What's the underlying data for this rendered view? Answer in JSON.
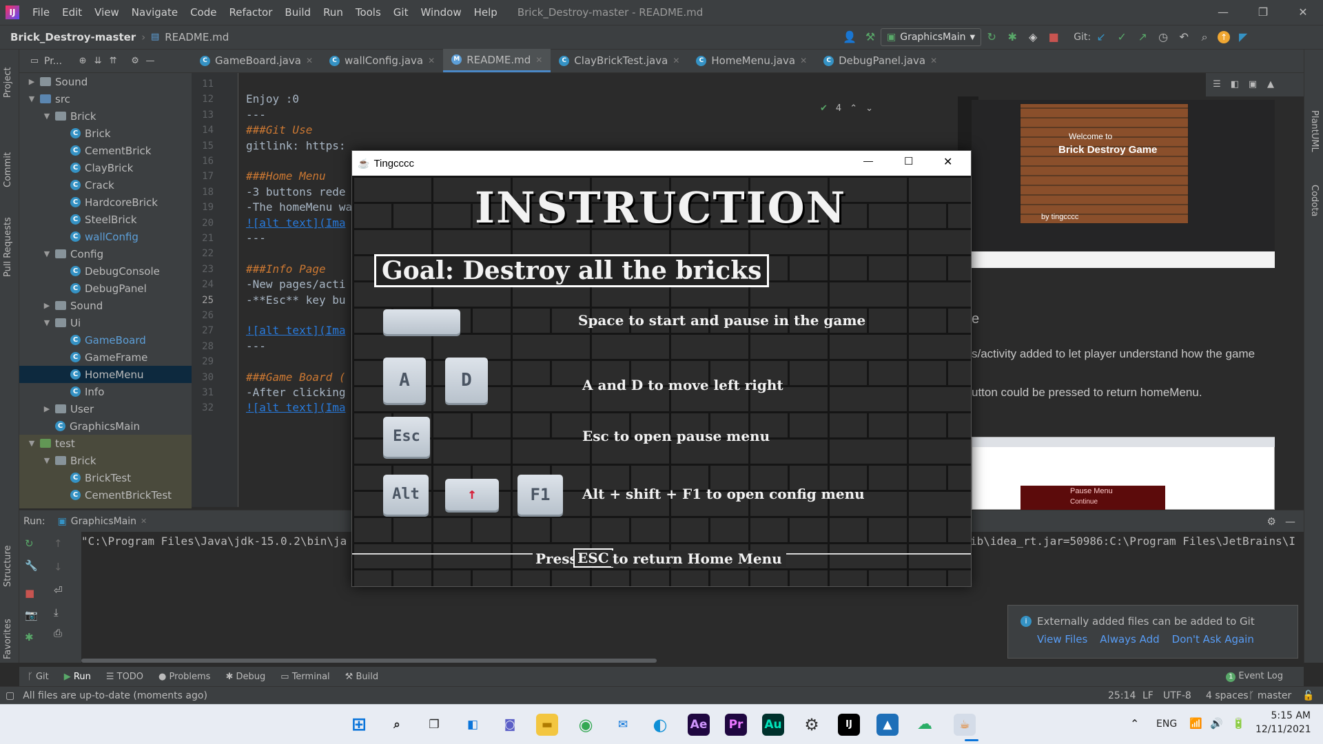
{
  "titlebar": {
    "menus": [
      "File",
      "Edit",
      "View",
      "Navigate",
      "Code",
      "Refactor",
      "Build",
      "Run",
      "Tools",
      "Git",
      "Window",
      "Help"
    ],
    "window_title": "Brick_Destroy-master - README.md"
  },
  "navbar": {
    "project": "Brick_Destroy-master",
    "file": "README.md",
    "run_config": "GraphicsMain",
    "git_label": "Git:"
  },
  "left_strip": {
    "tabs": [
      "Project",
      "Commit",
      "Pull Requests",
      "Structure",
      "Favorites"
    ]
  },
  "right_strip": {
    "tabs": [
      "PlantUML",
      "Codota"
    ]
  },
  "project_panel": {
    "header": "Pr...",
    "tree": [
      {
        "label": "Sound",
        "indent": 1,
        "type": "folder",
        "arrow": "▶"
      },
      {
        "label": "src",
        "indent": 1,
        "type": "src",
        "arrow": "▼"
      },
      {
        "label": "Brick",
        "indent": 2,
        "type": "folder",
        "arrow": "▼"
      },
      {
        "label": "Brick",
        "indent": 3,
        "type": "class"
      },
      {
        "label": "CementBrick",
        "indent": 3,
        "type": "class"
      },
      {
        "label": "ClayBrick",
        "indent": 3,
        "type": "class"
      },
      {
        "label": "Crack",
        "indent": 3,
        "type": "class"
      },
      {
        "label": "HardcoreBrick",
        "indent": 3,
        "type": "class"
      },
      {
        "label": "SteelBrick",
        "indent": 3,
        "type": "class"
      },
      {
        "label": "wallConfig",
        "indent": 3,
        "type": "class",
        "blue": true
      },
      {
        "label": "Config",
        "indent": 2,
        "type": "folder",
        "arrow": "▼"
      },
      {
        "label": "DebugConsole",
        "indent": 3,
        "type": "class"
      },
      {
        "label": "DebugPanel",
        "indent": 3,
        "type": "class"
      },
      {
        "label": "Sound",
        "indent": 2,
        "type": "folder",
        "arrow": "▶"
      },
      {
        "label": "Ui",
        "indent": 2,
        "type": "folder",
        "arrow": "▼"
      },
      {
        "label": "GameBoard",
        "indent": 3,
        "type": "class",
        "blue": true
      },
      {
        "label": "GameFrame",
        "indent": 3,
        "type": "class"
      },
      {
        "label": "HomeMenu",
        "indent": 3,
        "type": "class",
        "selected": true
      },
      {
        "label": "Info",
        "indent": 3,
        "type": "class"
      },
      {
        "label": "User",
        "indent": 2,
        "type": "folder",
        "arrow": "▶"
      },
      {
        "label": "GraphicsMain",
        "indent": 2,
        "type": "class"
      },
      {
        "label": "test",
        "indent": 1,
        "type": "test",
        "arrow": "▼"
      },
      {
        "label": "Brick",
        "indent": 2,
        "type": "folder",
        "arrow": "▼"
      },
      {
        "label": "BrickTest",
        "indent": 3,
        "type": "class"
      },
      {
        "label": "CementBrickTest",
        "indent": 3,
        "type": "class"
      }
    ]
  },
  "editor_tabs": [
    {
      "label": "GameBoard.java"
    },
    {
      "label": "wallConfig.java"
    },
    {
      "label": "README.md",
      "active": true
    },
    {
      "label": "ClayBrickTest.java"
    },
    {
      "label": "HomeMenu.java"
    },
    {
      "label": "DebugPanel.java"
    }
  ],
  "editor": {
    "line_numbers": [
      "11",
      "12",
      "13",
      "14",
      "15",
      "16",
      "17",
      "18",
      "19",
      "20",
      "21",
      "22",
      "23",
      "24",
      "25",
      "26",
      "27",
      "28",
      "29",
      "30",
      "31",
      "32"
    ],
    "current_line": "25",
    "lines": [
      "",
      "Enjoy :0",
      "---",
      "###Git Use",
      "gitlink: https:",
      "",
      "###Home Menu",
      "-3 buttons rede",
      "-The homeMenu wa",
      "![alt text](Ima",
      "---",
      "",
      "###Info Page",
      "-New pages/acti",
      "-**Esc** key bu",
      "",
      "![alt text](Ima",
      "---",
      "",
      "###Game Board (",
      "-After clicking",
      "![alt text](Ima"
    ],
    "inspection": "4"
  },
  "preview": {
    "heading_fragment": "e",
    "para1": "s/activity added to let player understand how the game",
    "para2": "utton could be pressed to return homeMenu.",
    "thumb_title": "Brick Destroy Game",
    "thumb_welcome": "Welcome to",
    "thumb_by": "by tingcccc",
    "thumb2_button": "Pause Menu",
    "thumb2_button2": "Continue"
  },
  "game_window": {
    "title": "Tingcccc",
    "heading": "INSTRUCTION",
    "goal": "Goal: Destroy all the bricks",
    "rows": [
      {
        "keys": [
          ""
        ],
        "text": "Space to start and pause in the game"
      },
      {
        "keys": [
          "A",
          "D"
        ],
        "text": "A and D to move left right"
      },
      {
        "keys": [
          "Esc"
        ],
        "text": "Esc to open pause menu"
      },
      {
        "keys": [
          "Alt",
          "↑",
          "F1"
        ],
        "text": "Alt + shift + F1 to open config menu"
      }
    ],
    "footer_pre": "Press",
    "footer_key": "ESC",
    "footer_post": "to return Home Menu"
  },
  "run_panel": {
    "label": "Run:",
    "tab": "GraphicsMain",
    "output_left": "\"C:\\Program Files\\Java\\jdk-15.0.2\\bin\\ja",
    "output_right": "ib\\idea_rt.jar=50986:C:\\Program Files\\JetBrains\\I"
  },
  "notification": {
    "message": "Externally added files can be added to Git",
    "actions": [
      "View Files",
      "Always Add",
      "Don't Ask Again"
    ]
  },
  "tool_tabs": [
    "Git",
    "Run",
    "TODO",
    "Problems",
    "Debug",
    "Terminal",
    "Build"
  ],
  "event_log": "Event Log",
  "status": {
    "message": "All files are up-to-date (moments ago)",
    "position": "25:14",
    "line_sep": "LF",
    "encoding": "UTF-8",
    "indent": "4 spaces",
    "branch": "master"
  },
  "taskbar": {
    "lang": "ENG",
    "time": "5:15 AM",
    "date": "12/11/2021",
    "apps": [
      "Ae",
      "Pr",
      "Au"
    ]
  },
  "colors": {
    "accent": "#4a88c7",
    "bg": "#2b2b2b",
    "panel": "#3c3f41",
    "header_orange": "#cc7832",
    "link": "#287bde"
  }
}
